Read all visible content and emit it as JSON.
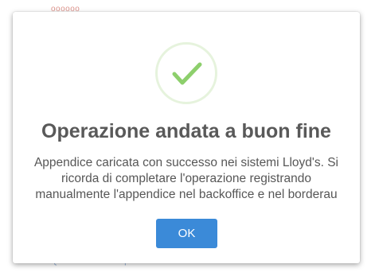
{
  "background": {
    "top_text": "oooooo",
    "bottom_text": "QUEST.Zucchini T.pdf"
  },
  "dialog": {
    "icon": "checkmark-success-icon",
    "title": "Operazione andata a buon fine",
    "message_lines": [
      "Appendice caricata con successo nei sistemi Lloyd's. Si",
      "ricorda di completare l'operazione registrando",
      "manualmente l'appendice nel backoffice e nel borderau"
    ],
    "ok_label": "OK"
  },
  "colors": {
    "success_green": "#8dcf6c",
    "success_ring": "#e6f3dd",
    "button_blue": "#3b8ad8",
    "title_gray": "#595959",
    "text_gray": "#575757"
  }
}
